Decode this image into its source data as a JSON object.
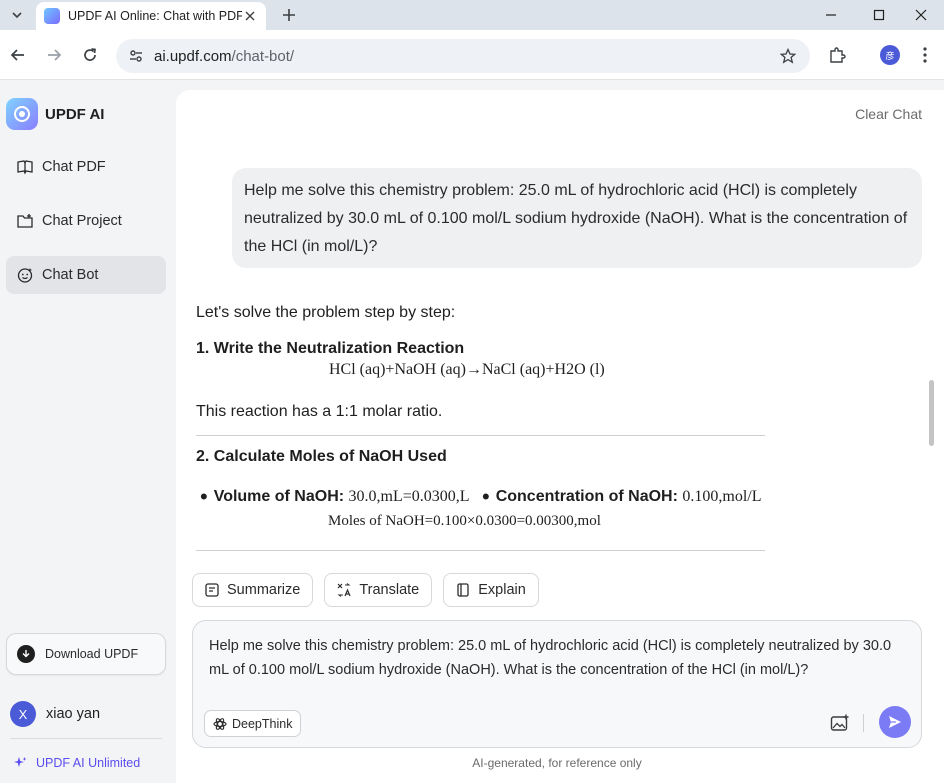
{
  "browser": {
    "tab_title": "UPDF AI Online: Chat with PDF",
    "url_host": "ai.updf.com",
    "url_path": "/chat-bot/",
    "profile_initial": "彦"
  },
  "sidebar": {
    "brand": "UPDF AI",
    "items": [
      {
        "label": "Chat PDF",
        "icon": "open-book-icon"
      },
      {
        "label": "Chat Project",
        "icon": "folder-icon"
      },
      {
        "label": "Chat Bot",
        "icon": "bot-face-icon",
        "active": true
      }
    ],
    "download_label": "Download UPDF",
    "user": {
      "initial": "X",
      "name": "xiao yan"
    },
    "unlimited_label": "UPDF AI Unlimited"
  },
  "main": {
    "clear_chat": "Clear Chat",
    "user_message": "Help me solve this chemistry problem: 25.0 mL of hydrochloric acid (HCl) is completely neutralized by 30.0 mL of 0.100 mol/L sodium hydroxide (NaOH). What is the concentration of the HCl (in mol/L)?",
    "answer": {
      "intro": "Let's solve the problem step by step:",
      "step1_heading": "1. Write the Neutralization Reaction",
      "equation": "HCl (aq)+NaOH (aq)→NaCl (aq)+H2O (l)",
      "ratio_text": "This reaction has a 1:1 molar ratio.",
      "step2_heading": "2. Calculate Moles of NaOH Used",
      "bullet1_label": "Volume of NaOH:",
      "bullet1_value": "30.0,mL=0.0300,L",
      "bullet2_label": "Concentration of NaOH:",
      "bullet2_value": "0.100,mol/L",
      "moles_equation": "Moles of NaOH=0.100×0.0300=0.00300,mol"
    },
    "actions": [
      {
        "label": "Summarize",
        "icon": "summarize-icon"
      },
      {
        "label": "Translate",
        "icon": "translate-icon"
      },
      {
        "label": "Explain",
        "icon": "book-icon"
      }
    ],
    "composer_text": "Help me solve this chemistry problem: 25.0 mL of hydrochloric acid (HCl) is completely neutralized by 30.0 mL of 0.100 mol/L sodium hydroxide (NaOH). What is the concentration of the HCl (in mol/L)?",
    "deepthink_label": "DeepThink",
    "disclaimer": "AI-generated, for reference only"
  },
  "colors": {
    "accent": "#7b7cf5",
    "brand_purple": "#5b4df0",
    "sidebar_bg": "#f3f4f6",
    "bubble_bg": "#eff0f2"
  }
}
